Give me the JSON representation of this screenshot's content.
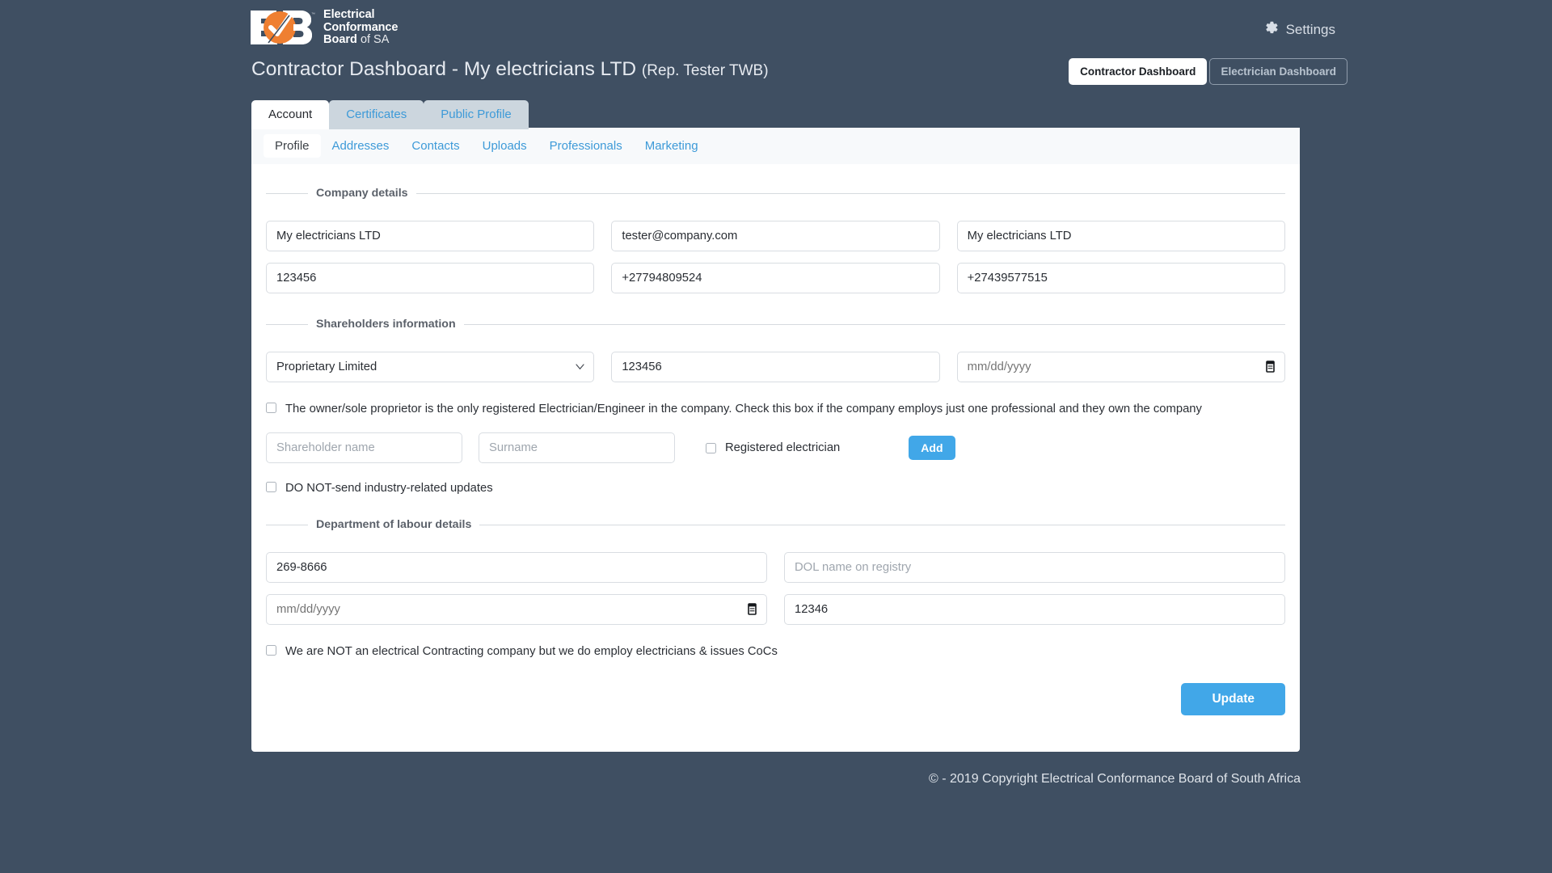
{
  "brand": {
    "logo_line1": "Electrical",
    "logo_line2": "Conformance",
    "logo_line3_bold": "Board",
    "logo_line3_light": "of SA",
    "logo_letters": "ECB",
    "accent_orange": "#ef7f31",
    "header_bg": "#3f4f62",
    "link_blue": "#3d9ad8",
    "button_blue": "#41a7e8"
  },
  "header": {
    "settings_label": "Settings",
    "settings_icon": "gear-icon"
  },
  "title": {
    "main": "Contractor Dashboard - My electricians LTD",
    "rep": "(Rep. Tester TWB)"
  },
  "dashboard_switch": {
    "contractor": "Contractor Dashboard",
    "electrician": "Electrician Dashboard",
    "active": "Contractor Dashboard"
  },
  "tabs": [
    {
      "label": "Account",
      "active": true
    },
    {
      "label": "Certificates",
      "active": false
    },
    {
      "label": "Public Profile",
      "active": false
    }
  ],
  "subtabs": [
    {
      "label": "Profile",
      "active": true
    },
    {
      "label": "Addresses",
      "active": false
    },
    {
      "label": "Contacts",
      "active": false
    },
    {
      "label": "Uploads",
      "active": false
    },
    {
      "label": "Professionals",
      "active": false
    },
    {
      "label": "Marketing",
      "active": false
    }
  ],
  "company_details": {
    "legend": "Company details",
    "company_name": "My electricians LTD",
    "email": "tester@company.com",
    "trading_name": "My electricians LTD",
    "registration_number": "123456",
    "phone_primary": "+27794809524",
    "phone_secondary": "+27439577515"
  },
  "shareholders": {
    "legend": "Shareholders information",
    "company_type_selected": "Proprietary Limited",
    "company_type_options": [
      "Proprietary Limited"
    ],
    "company_number": "123456",
    "date_placeholder": "mm/dd/yyyy",
    "sole_proprietor_checkbox": "The owner/sole proprietor is the only registered Electrician/Engineer in the company. Check this box if the company employs just one professional and they own the company",
    "shareholder_name_placeholder": "Shareholder name",
    "surname_placeholder": "Surname",
    "registered_electrician_label": "Registered electrician",
    "add_label": "Add",
    "no_updates_label": "DO NOT-send industry-related updates"
  },
  "dol": {
    "legend": "Department of labour details",
    "dol_number": "269-8666",
    "dol_name_placeholder": "DOL name on registry",
    "date_placeholder": "mm/dd/yyyy",
    "dol_extra": "12346",
    "not_contracting_label": "We are NOT an electrical Contracting company but we do employ electricians & issues CoCs"
  },
  "actions": {
    "update_label": "Update"
  },
  "footer": {
    "copyright": "© - 2019 Copyright Electrical Conformance Board of South Africa"
  }
}
